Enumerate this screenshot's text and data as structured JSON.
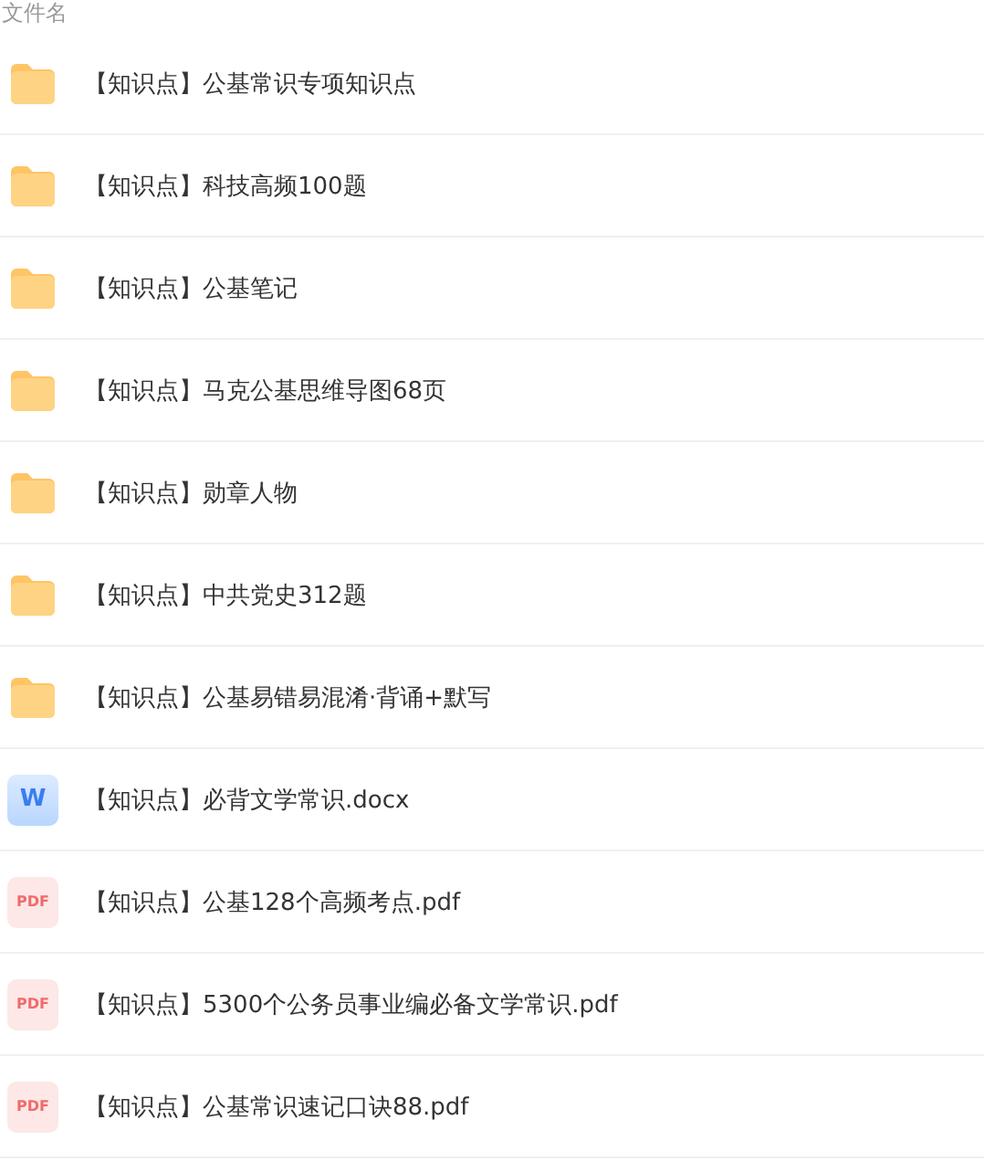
{
  "header": {
    "column_label": "文件名"
  },
  "files": [
    {
      "kind": "folder",
      "name": "【知识点】公基常识专项知识点"
    },
    {
      "kind": "folder",
      "name": "【知识点】科技高频100题"
    },
    {
      "kind": "folder",
      "name": "【知识点】公基笔记"
    },
    {
      "kind": "folder",
      "name": "【知识点】马克公基思维导图68页"
    },
    {
      "kind": "folder",
      "name": "【知识点】勋章人物"
    },
    {
      "kind": "folder",
      "name": "【知识点】中共党史312题"
    },
    {
      "kind": "folder",
      "name": "【知识点】公基易错易混淆·背诵+默写"
    },
    {
      "kind": "word",
      "icon_text": "W",
      "name": "【知识点】必背文学常识.docx"
    },
    {
      "kind": "pdf",
      "icon_text": "PDF",
      "name": "【知识点】公基128个高频考点.pdf"
    },
    {
      "kind": "pdf",
      "icon_text": "PDF",
      "name": "【知识点】5300个公务员事业编必备文学常识.pdf"
    },
    {
      "kind": "pdf",
      "icon_text": "PDF",
      "name": "【知识点】公基常识速记口诀88.pdf"
    }
  ]
}
